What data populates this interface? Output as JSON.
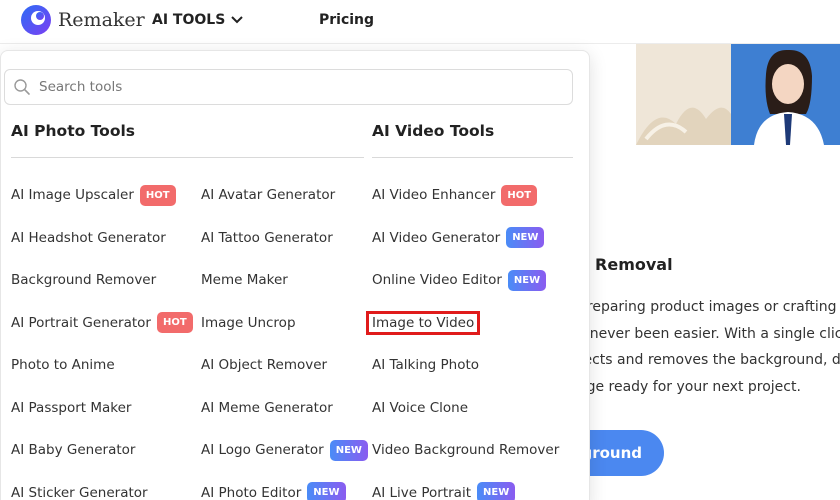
{
  "header": {
    "brand": "Remaker",
    "nav_tools_label": "AI TOOLS",
    "nav_pricing_label": "Pricing"
  },
  "search": {
    "placeholder": "Search tools"
  },
  "photo_section": {
    "title": "AI Photo Tools"
  },
  "video_section": {
    "title": "AI Video Tools"
  },
  "photo_tools_col1": [
    {
      "label": "AI Image Upscaler",
      "badge": "HOT"
    },
    {
      "label": "AI Headshot Generator"
    },
    {
      "label": "Background Remover"
    },
    {
      "label": "AI Portrait Generator",
      "badge": "HOT"
    },
    {
      "label": "Photo to Anime"
    },
    {
      "label": "AI Passport Maker"
    },
    {
      "label": "AI Baby Generator"
    },
    {
      "label": "AI Sticker Generator"
    }
  ],
  "photo_tools_col2": [
    {
      "label": "AI Avatar Generator"
    },
    {
      "label": "AI Tattoo Generator"
    },
    {
      "label": "Meme Maker"
    },
    {
      "label": "Image Uncrop"
    },
    {
      "label": "AI Object Remover"
    },
    {
      "label": "AI Meme Generator"
    },
    {
      "label": "AI Logo Generator",
      "badge": "NEW"
    },
    {
      "label": "AI Photo Editor",
      "badge": "NEW"
    }
  ],
  "video_tools": [
    {
      "label": "AI Video Enhancer",
      "badge": "HOT"
    },
    {
      "label": "AI Video Generator",
      "badge": "NEW"
    },
    {
      "label": "Online Video Editor",
      "badge": "NEW"
    },
    {
      "label": "Image to Video",
      "highlighted": true
    },
    {
      "label": "AI Talking Photo"
    },
    {
      "label": "AI Voice Clone"
    },
    {
      "label": "Video Background Remover"
    },
    {
      "label": "AI Live Portrait",
      "badge": "NEW"
    }
  ],
  "background": {
    "feature_title": "d Removal",
    "feature_lines": [
      "preparing product images or crafting a",
      "s never been easier. With a single click",
      "tects and removes the background, deli",
      "age ready for your next project."
    ],
    "button_label": "kground"
  },
  "colors": {
    "hot_badge": "#f26b6b",
    "new_badge_start": "#4a8cf7",
    "new_badge_end": "#8a5cf0",
    "highlight_border": "#e01b1b",
    "primary_button": "#4b88f0"
  }
}
